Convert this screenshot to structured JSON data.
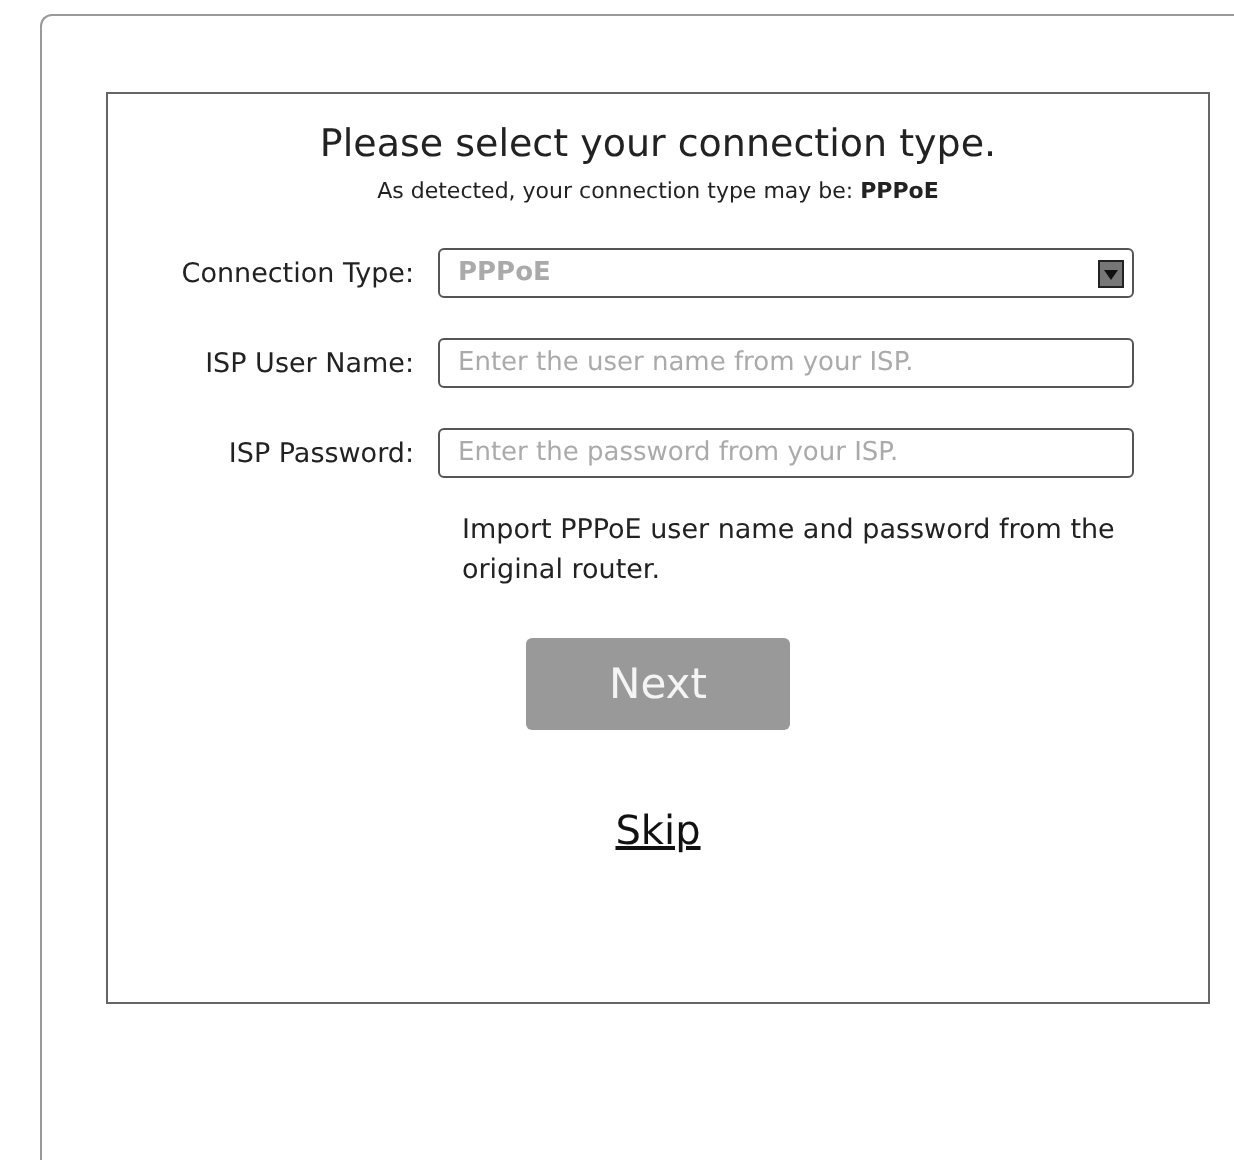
{
  "title": "Please select your connection type.",
  "subtitle": "As detected, your connection type may be: **PPPoE**",
  "fields": [
    {
      "kind": "select",
      "label": "Connection Type:",
      "value": "PPPoE"
    },
    {
      "kind": "text",
      "label": "ISP User Name:",
      "placeholder": "Enter the user name from your ISP."
    },
    {
      "kind": "text",
      "label": "ISP Password:",
      "placeholder": "Enter the password from your ISP."
    }
  ],
  "import_note": "Import PPPoE user name and password from the original router.",
  "next_button": {
    "label": "Next",
    "disabled": true
  },
  "skip_link": "Skip"
}
